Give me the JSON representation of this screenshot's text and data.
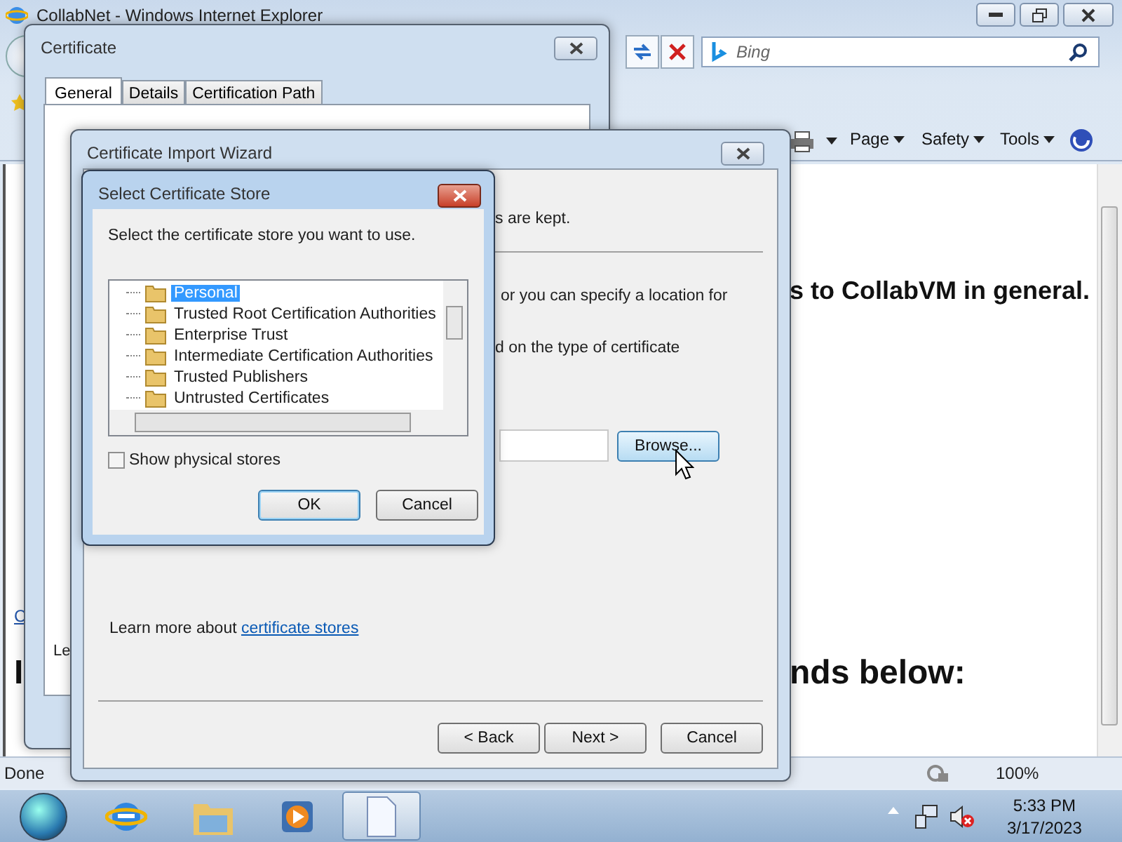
{
  "browser": {
    "title": "CollabNet - Windows Internet Explorer",
    "search": {
      "placeholder": "Bing"
    },
    "command_bar": [
      {
        "label": "Page"
      },
      {
        "label": "Safety"
      },
      {
        "label": "Tools"
      }
    ],
    "page_fragments": [
      {
        "kind": "link",
        "text": "C"
      },
      {
        "kind": "heading",
        "text": "I"
      },
      {
        "kind": "heading",
        "text": "s to CollabVM in general."
      },
      {
        "kind": "heading",
        "text": "nds below:"
      }
    ],
    "status": "Done",
    "zoom": "100%"
  },
  "certificate_dialog": {
    "title": "Certificate",
    "tabs": [
      {
        "label": "General",
        "selected": true
      },
      {
        "label": "Details",
        "selected": false
      },
      {
        "label": "Certification Path",
        "selected": false
      }
    ],
    "fragment": "Le"
  },
  "import_wizard": {
    "title": "Certificate Import Wizard",
    "fragments": [
      "s are kept.",
      "or you can specify a location for",
      "d on the type of certificate"
    ],
    "browse_button": "Browse...",
    "learn_more": {
      "text": "Learn more about",
      "link": "certificate stores"
    },
    "buttons": [
      "< Back",
      "Next >",
      "Cancel"
    ]
  },
  "select_store_dialog": {
    "title": "Select Certificate Store",
    "instruction": "Select the certificate store you want to use.",
    "stores": [
      {
        "label": "Personal",
        "selected": true
      },
      {
        "label": "Trusted Root Certification Authorities",
        "selected": false
      },
      {
        "label": "Enterprise Trust",
        "selected": false
      },
      {
        "label": "Intermediate Certification Authorities",
        "selected": false
      },
      {
        "label": "Trusted Publishers",
        "selected": false
      },
      {
        "label": "Untrusted Certificates",
        "selected": false
      }
    ],
    "show_physical_stores": {
      "label": "Show physical stores",
      "checked": false
    },
    "buttons": [
      "OK",
      "Cancel"
    ]
  },
  "taskbar": {
    "apps": [
      {
        "kind": "browser",
        "selected": false
      },
      {
        "kind": "folder",
        "selected": false
      },
      {
        "kind": "media",
        "selected": false
      },
      {
        "kind": "document",
        "selected": true
      }
    ],
    "time": "5:33 PM",
    "date": "3/17/2023"
  }
}
